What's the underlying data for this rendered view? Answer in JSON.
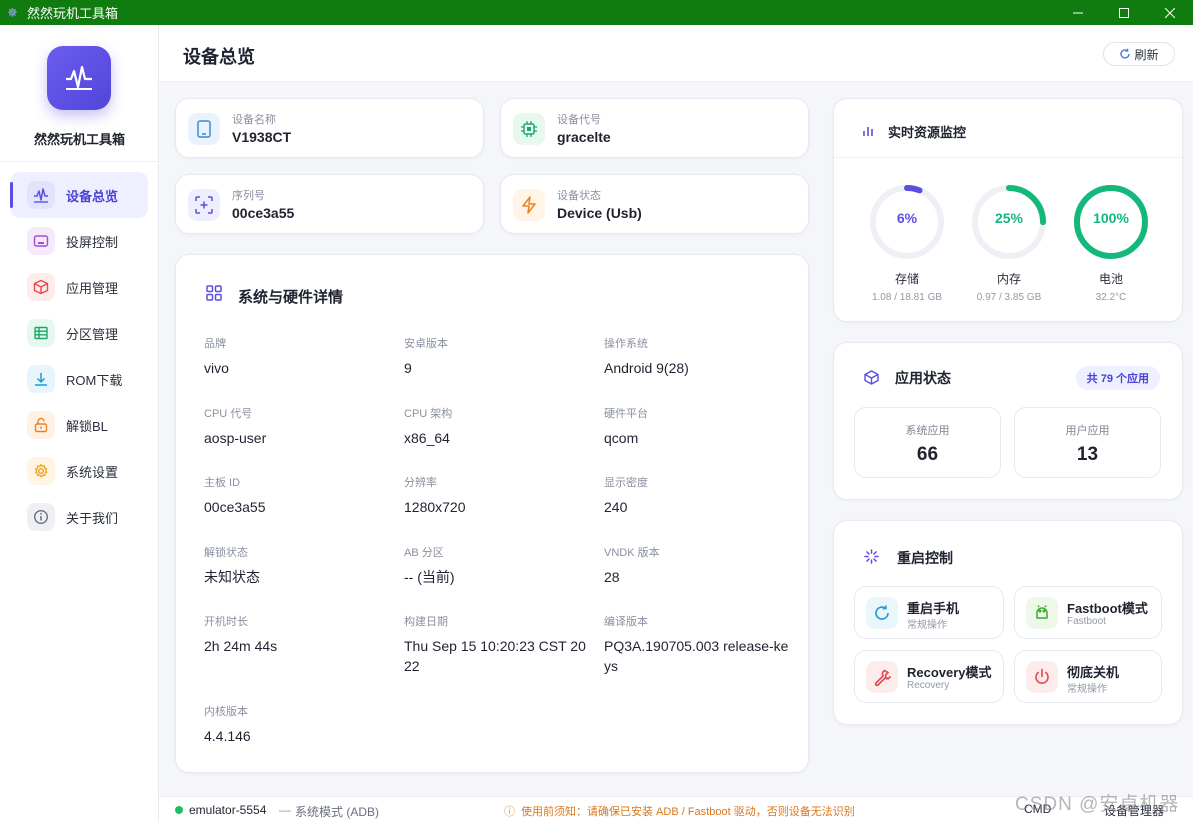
{
  "window": {
    "title": "然然玩机工具箱"
  },
  "sidebar": {
    "app_name": "然然玩机工具箱",
    "items": [
      {
        "label": "设备总览",
        "icon": "chart-icon",
        "active": true,
        "color": "#5b4fe0"
      },
      {
        "label": "投屏控制",
        "icon": "cast-icon",
        "color": "#a24cd6"
      },
      {
        "label": "应用管理",
        "icon": "package-icon",
        "color": "#e5484d"
      },
      {
        "label": "分区管理",
        "icon": "partition-icon",
        "color": "#1aa96b"
      },
      {
        "label": "ROM下载",
        "icon": "download-icon",
        "color": "#1b9bd1"
      },
      {
        "label": "解锁BL",
        "icon": "unlock-icon",
        "color": "#e8821f"
      },
      {
        "label": "系统设置",
        "icon": "gear-icon",
        "color": "#e8a01f"
      },
      {
        "label": "关于我们",
        "icon": "info-icon",
        "color": "#6a7080"
      }
    ]
  },
  "header": {
    "title": "设备总览",
    "refresh_label": "刷新"
  },
  "device_cards": [
    {
      "label": "设备名称",
      "value": "V1938CT",
      "icon": "phone-icon"
    },
    {
      "label": "设备代号",
      "value": "gracelte",
      "icon": "chip-icon"
    },
    {
      "label": "序列号",
      "value": "00ce3a55",
      "icon": "scan-icon"
    },
    {
      "label": "设备状态",
      "value": "Device (Usb)",
      "icon": "bolt-icon"
    }
  ],
  "details": {
    "title": "系统与硬件详情",
    "fields": [
      {
        "label": "品牌",
        "value": "vivo"
      },
      {
        "label": "安卓版本",
        "value": "9"
      },
      {
        "label": "操作系统",
        "value": "Android 9(28)"
      },
      {
        "label": "CPU 代号",
        "value": "aosp-user"
      },
      {
        "label": "CPU 架构",
        "value": "x86_64"
      },
      {
        "label": "硬件平台",
        "value": "qcom"
      },
      {
        "label": "主板 ID",
        "value": "00ce3a55"
      },
      {
        "label": "分辨率",
        "value": "1280x720"
      },
      {
        "label": "显示密度",
        "value": "240"
      },
      {
        "label": "解锁状态",
        "value": "未知状态"
      },
      {
        "label": "AB 分区",
        "value": "-- (当前)"
      },
      {
        "label": "VNDK 版本",
        "value": "28"
      },
      {
        "label": "开机时长",
        "value": "2h 24m 44s"
      },
      {
        "label": "构建日期",
        "value": "Thu Sep 15 10:20:23 CST 2022"
      },
      {
        "label": "编译版本",
        "value": "PQ3A.190705.003 release-keys"
      },
      {
        "label": "内核版本",
        "value": "4.4.146"
      }
    ]
  },
  "monitor": {
    "title": "实时资源监控",
    "gauges": [
      {
        "value_text": "6%",
        "fraction": 0.06,
        "name": "存储",
        "sub": "1.08 / 18.81 GB",
        "color": "#5b4fe0"
      },
      {
        "value_text": "25%",
        "fraction": 0.25,
        "name": "内存",
        "sub": "0.97 / 3.85 GB",
        "color": "#14b87a"
      },
      {
        "value_text": "100%",
        "fraction": 1.0,
        "name": "电池",
        "sub": "32.2°C",
        "color": "#14b87a"
      }
    ]
  },
  "apps": {
    "title": "应用状态",
    "total": "共 79 个应用",
    "system_label": "系统应用",
    "system_value": "66",
    "user_label": "用户应用",
    "user_value": "13"
  },
  "reboot": {
    "title": "重启控制",
    "buttons": [
      {
        "title": "重启手机",
        "sub": "常规操作",
        "icon": "restart-icon",
        "color": "#1b9bd1"
      },
      {
        "title": "Fastboot模式",
        "sub": "Fastboot",
        "icon": "android-icon",
        "color": "#3dab2e"
      },
      {
        "title": "Recovery模式",
        "sub": "Recovery",
        "icon": "wrench-icon",
        "color": "#e5484d"
      },
      {
        "title": "彻底关机",
        "sub": "常规操作",
        "icon": "power-icon",
        "color": "#e5484d"
      }
    ]
  },
  "statusbar": {
    "device": "emulator-5554",
    "separator": "—",
    "mode": "系统模式 (ADB)",
    "warning": "使用前须知：请确保已安装 ADB / Fastboot 驱动，否则设备无法识别",
    "cmd": "CMD",
    "manager": "设备管理器"
  },
  "watermark": "CSDN @安卓机器"
}
